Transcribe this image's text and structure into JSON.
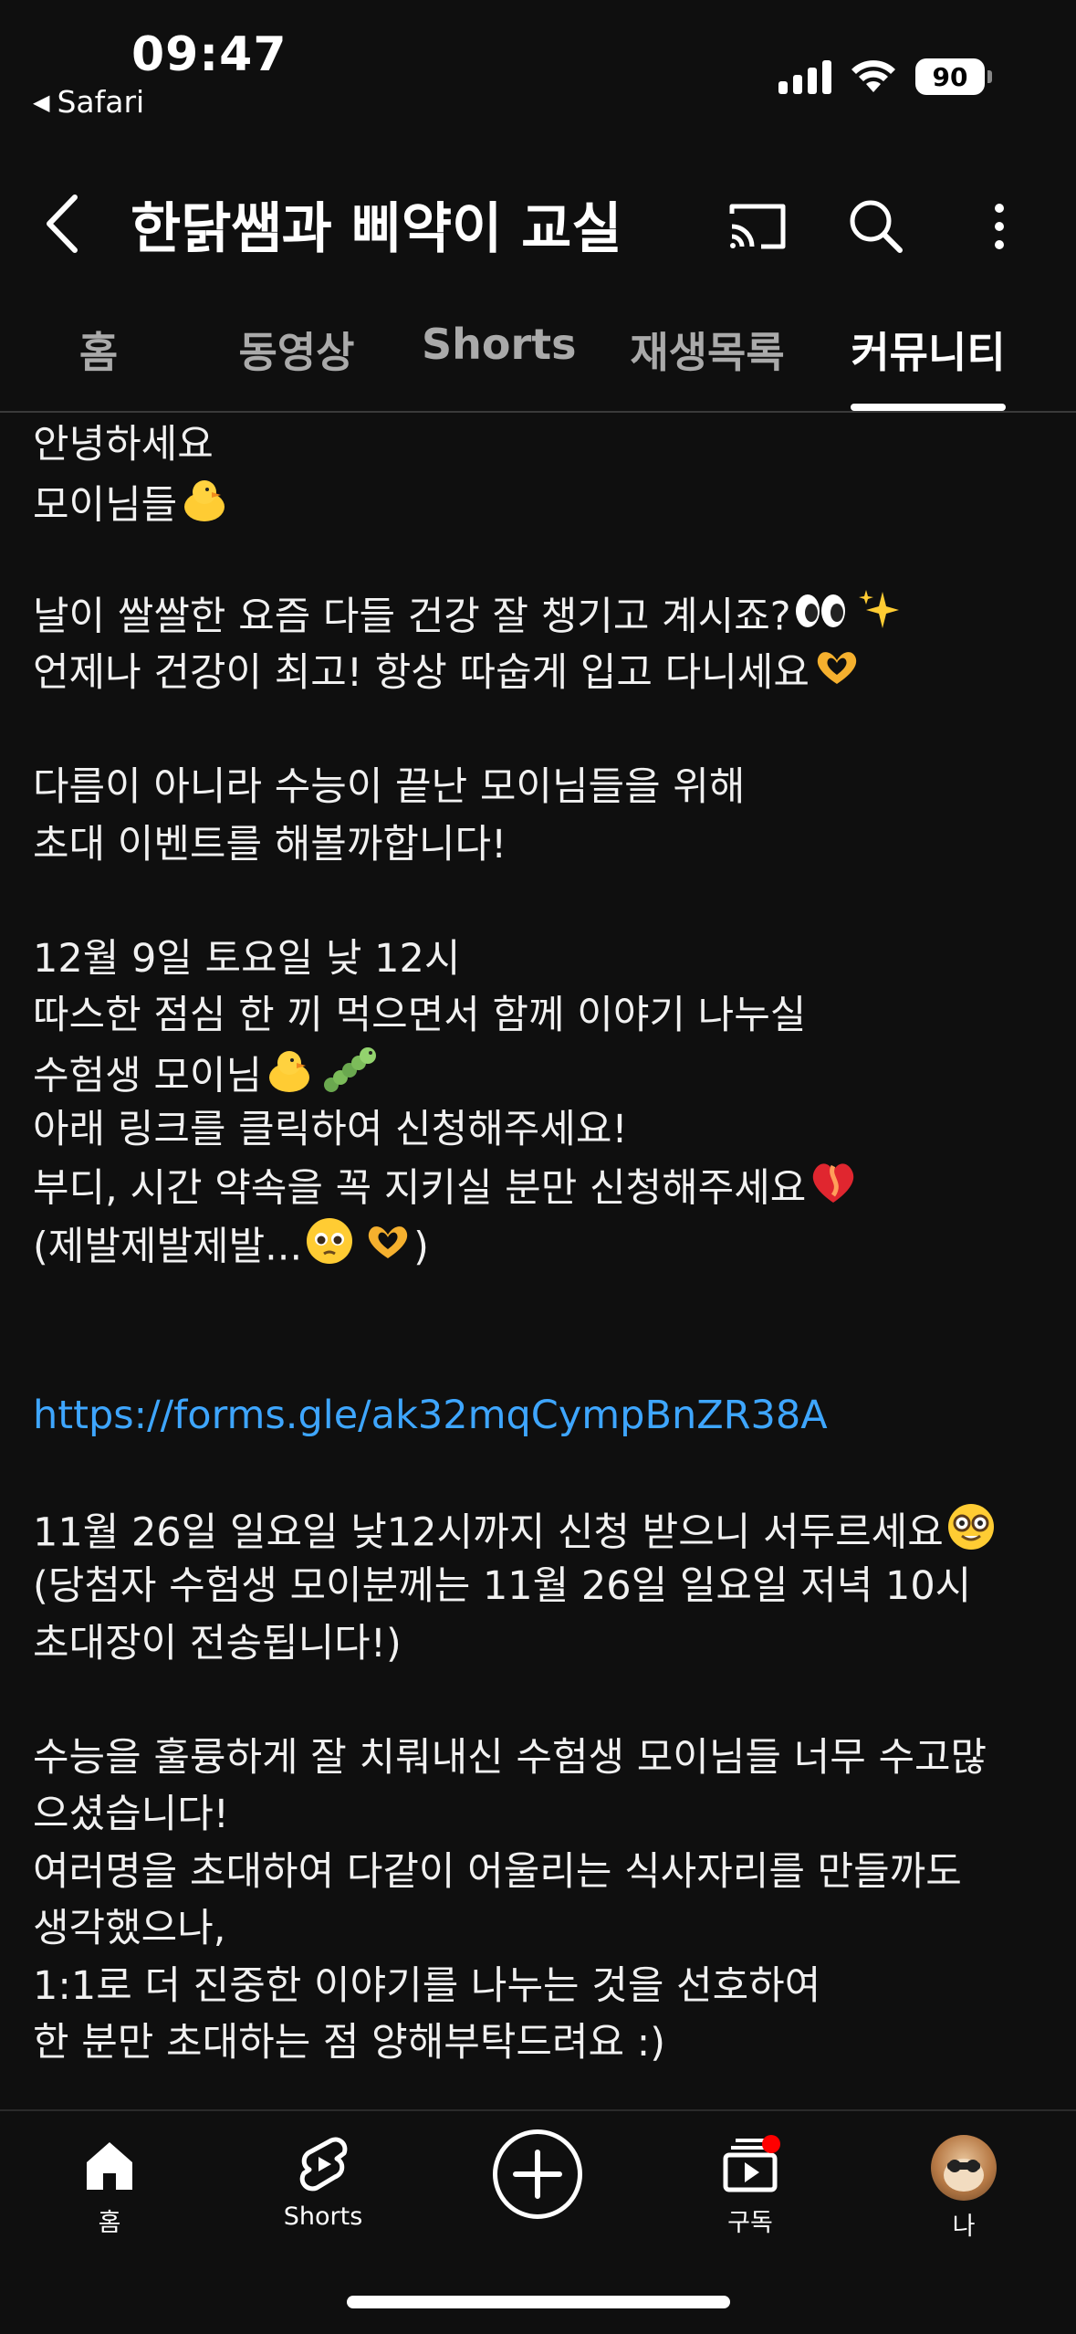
{
  "status_bar": {
    "time": "09:47",
    "back_app": "Safari",
    "battery": "90"
  },
  "header": {
    "title": "한닭쌤과 삐약이 교실",
    "icons": [
      "back-arrow-icon",
      "cast-icon",
      "search-icon",
      "more-vert-icon"
    ]
  },
  "tabs": [
    {
      "label": "홈",
      "active": false
    },
    {
      "label": "동영상",
      "active": false
    },
    {
      "label": "Shorts",
      "active": false
    },
    {
      "label": "재생목록",
      "active": false
    },
    {
      "label": "커뮤니티",
      "active": true
    }
  ],
  "post": {
    "lines": [
      "안녕하세요",
      "모이님들",
      "",
      "날이 쌀쌀한 요즘 다들 건강 잘 챙기고 계시죠?",
      "언제나 건강이 최고! 항상 따숩게 입고 다니세요",
      "",
      "다름이 아니라 수능이 끝난 모이님들을 위해",
      "초대 이벤트를 해볼까합니다!",
      "",
      "12월 9일 토요일 낮 12시",
      "따스한 점심 한 끼 먹으면서 함께 이야기 나누실",
      "수험생 모이님",
      "아래 링크를 클릭하여 신청해주세요!",
      "부디, 시간 약속을 꼭 지키실 분만 신청해주세요",
      "(제발제발제발...",
      "",
      "",
      "https://forms.gle/ak32mqCympBnZR38A",
      "",
      "11월 26일 일요일 낮12시까지 신청 받으니 서두르세요",
      "(당첨자 수험생 모이분께는 11월 26일 일요일 저녁 10시",
      "초대장이 전송됩니다!)",
      "",
      "수능을 훌륭하게 잘 치뤄내신 수험생 모이님들 너무 수고많",
      "으셨습니다!",
      "여러명을 초대하여 다같이 어울리는 식사자리를 만들까도",
      "생각했으나,",
      "1:1로 더 진중한 이야기를 나누는 것을 선호하여",
      "한 분만 초대하는 점 양해부탁드려요 :)"
    ],
    "paren_close": ")",
    "emojis": [
      "chick",
      "eyes",
      "sparkles",
      "heart-hands",
      "chick",
      "caterpillar",
      "mending-heart",
      "pleading-face",
      "heart-hands",
      "nerd-face"
    ]
  },
  "bottom_nav": {
    "items": [
      {
        "label": "홈",
        "icon": "home-icon"
      },
      {
        "label": "Shorts",
        "icon": "shorts-icon"
      },
      {
        "label": "",
        "icon": "create-plus-icon"
      },
      {
        "label": "구독",
        "icon": "subscriptions-icon"
      },
      {
        "label": "나",
        "icon": "avatar"
      }
    ],
    "notification_dot_color": "#ff0000"
  },
  "colors": {
    "background": "#0f0f0f",
    "text": "#f1f1f1",
    "tab_inactive": "#aaaaaa",
    "link": "#3ea6ff"
  }
}
